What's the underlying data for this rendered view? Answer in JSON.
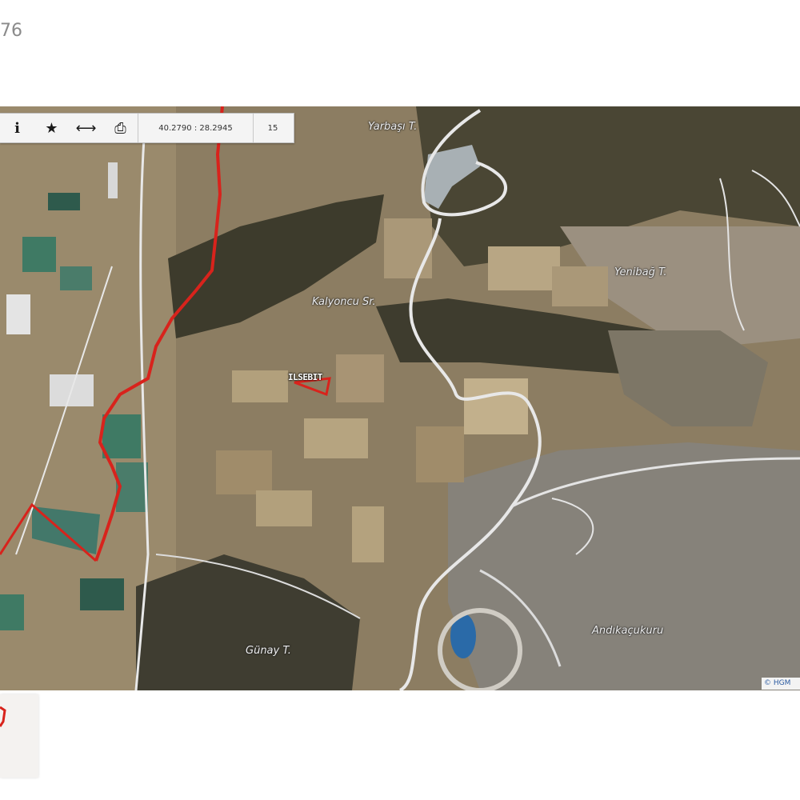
{
  "page": {
    "number_fragment": "76"
  },
  "toolbar": {
    "info_icon": "i",
    "favorite_icon": "★",
    "measure_icon": "⟷",
    "print_icon": "⎙",
    "coordinates": "40.2790 : 28.2945",
    "zoom": "15"
  },
  "map": {
    "labels": {
      "yarbasi": "Yarbaşı T.",
      "yenibag": "Yenibağ T.",
      "kalyoncu": "Kalyoncu Sr.",
      "gunay": "Günay T.",
      "andikacukuru": "Andıkaçukuru",
      "parcel": "ILSEBIT"
    },
    "attribution": "© HGM",
    "colors": {
      "boundary": "#d8231c",
      "road": "#e8e8e8",
      "water": "#2a6aa8"
    }
  }
}
